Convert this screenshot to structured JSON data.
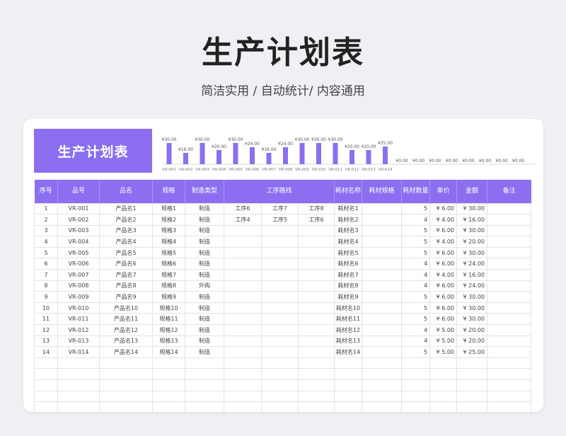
{
  "title": "生产计划表",
  "subtitle": "简洁实用 / 自动统计/ 内容通用",
  "banner_title": "生产计划表",
  "colors": {
    "accent": "#8b6ff0",
    "background": "#eef0f3"
  },
  "headers": {
    "seq": "序号",
    "code": "品号",
    "name": "品名",
    "spec": "规格",
    "make_type": "制造类型",
    "route": "工序路线",
    "mat_name": "耗材名称",
    "mat_spec": "耗材规格",
    "mat_qty": "耗材数量",
    "price": "单价",
    "amount": "金额",
    "note": "备注"
  },
  "rows": [
    {
      "seq": "1",
      "code": "VR-001",
      "name": "产品名1",
      "spec": "规格1",
      "type": "制造",
      "r1": "工序6",
      "r2": "工序7",
      "r3": "工序8",
      "mat": "耗材名1",
      "mspec": "",
      "qty": "5",
      "price": "¥ 6.00",
      "amount": "¥ 30.00",
      "note": ""
    },
    {
      "seq": "2",
      "code": "VR-002",
      "name": "产品名2",
      "spec": "规格2",
      "type": "制造",
      "r1": "工序4",
      "r2": "工序5",
      "r3": "工序6",
      "mat": "耗材名2",
      "mspec": "",
      "qty": "4",
      "price": "¥ 4.00",
      "amount": "¥ 16.00",
      "note": ""
    },
    {
      "seq": "3",
      "code": "VR-003",
      "name": "产品名3",
      "spec": "规格3",
      "type": "制造",
      "r1": "",
      "r2": "",
      "r3": "",
      "mat": "耗材名3",
      "mspec": "",
      "qty": "5",
      "price": "¥ 6.00",
      "amount": "¥ 30.00",
      "note": ""
    },
    {
      "seq": "4",
      "code": "VR-004",
      "name": "产品名4",
      "spec": "规格4",
      "type": "制造",
      "r1": "",
      "r2": "",
      "r3": "",
      "mat": "耗材名4",
      "mspec": "",
      "qty": "5",
      "price": "¥ 4.00",
      "amount": "¥ 20.00",
      "note": ""
    },
    {
      "seq": "5",
      "code": "VR-005",
      "name": "产品名5",
      "spec": "规格5",
      "type": "制造",
      "r1": "",
      "r2": "",
      "r3": "",
      "mat": "耗材名5",
      "mspec": "",
      "qty": "5",
      "price": "¥ 6.00",
      "amount": "¥ 30.00",
      "note": ""
    },
    {
      "seq": "6",
      "code": "VR-006",
      "name": "产品名6",
      "spec": "规格6",
      "type": "制造",
      "r1": "",
      "r2": "",
      "r3": "",
      "mat": "耗材名6",
      "mspec": "",
      "qty": "4",
      "price": "¥ 6.00",
      "amount": "¥ 24.00",
      "note": ""
    },
    {
      "seq": "7",
      "code": "VR-007",
      "name": "产品名7",
      "spec": "规格7",
      "type": "制造",
      "r1": "",
      "r2": "",
      "r3": "",
      "mat": "耗材名7",
      "mspec": "",
      "qty": "4",
      "price": "¥ 4.00",
      "amount": "¥ 16.00",
      "note": ""
    },
    {
      "seq": "8",
      "code": "VR-008",
      "name": "产品名8",
      "spec": "规格8",
      "type": "外购",
      "r1": "",
      "r2": "",
      "r3": "",
      "mat": "耗材名8",
      "mspec": "",
      "qty": "4",
      "price": "¥ 6.00",
      "amount": "¥ 24.00",
      "note": ""
    },
    {
      "seq": "9",
      "code": "VR-009",
      "name": "产品名9",
      "spec": "规格9",
      "type": "制造",
      "r1": "",
      "r2": "",
      "r3": "",
      "mat": "耗材名9",
      "mspec": "",
      "qty": "5",
      "price": "¥ 6.00",
      "amount": "¥ 30.00",
      "note": ""
    },
    {
      "seq": "10",
      "code": "VR-010",
      "name": "产品名10",
      "spec": "规格10",
      "type": "制造",
      "r1": "",
      "r2": "",
      "r3": "",
      "mat": "耗材名10",
      "mspec": "",
      "qty": "5",
      "price": "¥ 6.00",
      "amount": "¥ 30.00",
      "note": ""
    },
    {
      "seq": "11",
      "code": "VR-011",
      "name": "产品名11",
      "spec": "规格11",
      "type": "制造",
      "r1": "",
      "r2": "",
      "r3": "",
      "mat": "耗材名11",
      "mspec": "",
      "qty": "5",
      "price": "¥ 6.00",
      "amount": "¥ 30.00",
      "note": ""
    },
    {
      "seq": "12",
      "code": "VR-012",
      "name": "产品名12",
      "spec": "规格12",
      "type": "制造",
      "r1": "",
      "r2": "",
      "r3": "",
      "mat": "耗材名12",
      "mspec": "",
      "qty": "4",
      "price": "¥ 5.00",
      "amount": "¥ 20.00",
      "note": ""
    },
    {
      "seq": "13",
      "code": "VR-013",
      "name": "产品名13",
      "spec": "规格13",
      "type": "制造",
      "r1": "",
      "r2": "",
      "r3": "",
      "mat": "耗材名13",
      "mspec": "",
      "qty": "4",
      "price": "¥ 5.00",
      "amount": "¥ 20.00",
      "note": ""
    },
    {
      "seq": "14",
      "code": "VR-014",
      "name": "产品名14",
      "spec": "规格14",
      "type": "制造",
      "r1": "",
      "r2": "",
      "r3": "",
      "mat": "耗材名14",
      "mspec": "",
      "qty": "5",
      "price": "¥ 5.00",
      "amount": "¥ 25.00",
      "note": ""
    },
    {
      "seq": "",
      "code": "",
      "name": "",
      "spec": "",
      "type": "",
      "r1": "",
      "r2": "",
      "r3": "",
      "mat": "",
      "mspec": "",
      "qty": "",
      "price": "",
      "amount": "",
      "note": ""
    },
    {
      "seq": "",
      "code": "",
      "name": "",
      "spec": "",
      "type": "",
      "r1": "",
      "r2": "",
      "r3": "",
      "mat": "",
      "mspec": "",
      "qty": "",
      "price": "",
      "amount": "",
      "note": ""
    },
    {
      "seq": "",
      "code": "",
      "name": "",
      "spec": "",
      "type": "",
      "r1": "",
      "r2": "",
      "r3": "",
      "mat": "",
      "mspec": "",
      "qty": "",
      "price": "",
      "amount": "",
      "note": ""
    },
    {
      "seq": "",
      "code": "",
      "name": "",
      "spec": "",
      "type": "",
      "r1": "",
      "r2": "",
      "r3": "",
      "mat": "",
      "mspec": "",
      "qty": "",
      "price": "",
      "amount": "",
      "note": ""
    },
    {
      "seq": "",
      "code": "",
      "name": "",
      "spec": "",
      "type": "",
      "r1": "",
      "r2": "",
      "r3": "",
      "mat": "",
      "mspec": "",
      "qty": "",
      "price": "",
      "amount": "",
      "note": ""
    }
  ],
  "chart_data": {
    "type": "bar",
    "categories": [
      "VR-001",
      "VR-002",
      "VR-003",
      "VR-004",
      "VR-005",
      "VR-006",
      "VR-007",
      "VR-008",
      "VR-009",
      "VR-010",
      "VR-011",
      "VR-012",
      "VR-013",
      "VR-014",
      "",
      "",
      "",
      "",
      "",
      "",
      "",
      ""
    ],
    "values": [
      30,
      16,
      30,
      20,
      30,
      24,
      16,
      24,
      30,
      30,
      30,
      20,
      20,
      25,
      0,
      0,
      0,
      0,
      0,
      0,
      0,
      0
    ],
    "data_labels": [
      "¥30.00",
      "¥16.00",
      "¥30.00",
      "¥20.00",
      "¥30.00",
      "¥24.00",
      "¥16.00",
      "¥24.00",
      "¥30.00",
      "¥30.00",
      "¥30.00",
      "¥20.00",
      "¥20.00",
      "¥25.00",
      "¥0.00",
      "¥0.00",
      "¥0.00",
      "¥0.00",
      "¥0.00",
      "¥0.00",
      "¥0.00",
      "¥0.00"
    ],
    "title": "",
    "xlabel": "",
    "ylabel": "",
    "ylim": [
      0,
      30
    ],
    "grid": false
  }
}
